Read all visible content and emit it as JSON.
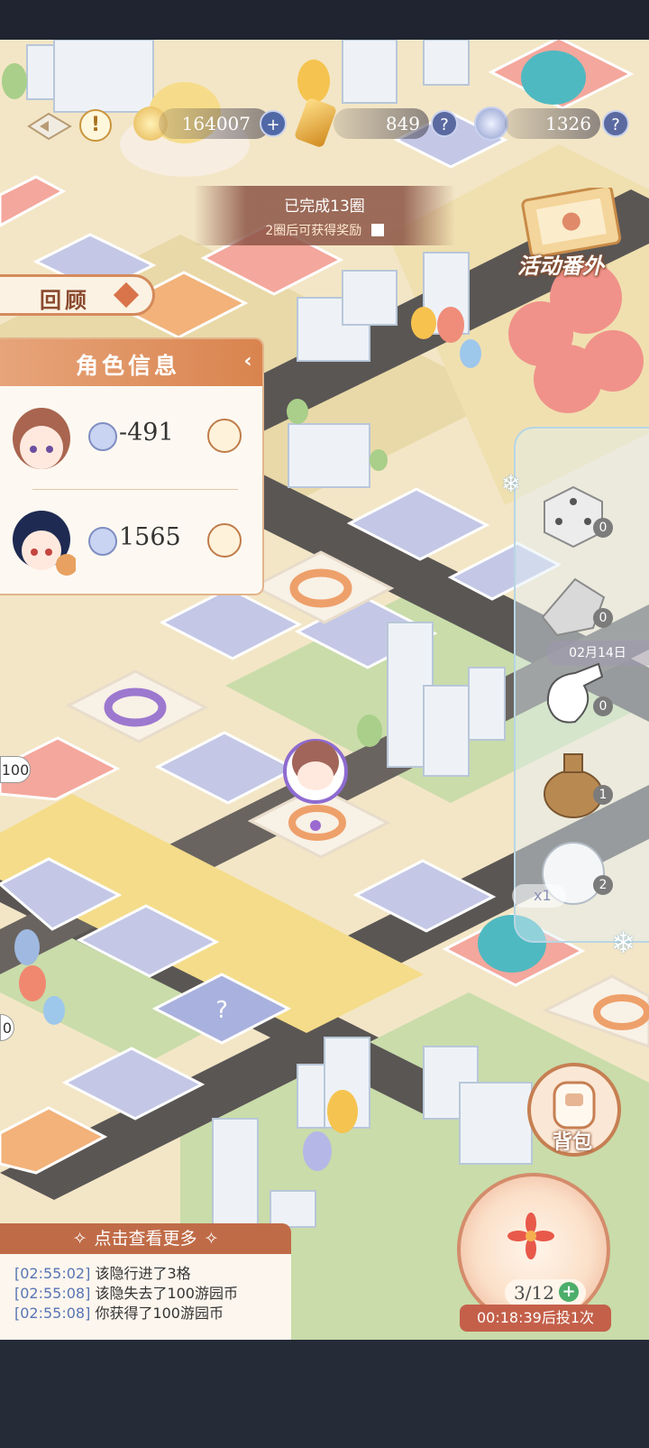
{
  "currencies": [
    {
      "value": "164007",
      "icon": "star-coin-icon",
      "action": "+"
    },
    {
      "value": "849",
      "icon": "gold-crystal-icon",
      "action": "?"
    },
    {
      "value": "1326",
      "icon": "silver-coin-icon",
      "action": "?"
    }
  ],
  "round_banner": {
    "completed": "已完成13圈",
    "reward_hint": "2圈后可获得奖励"
  },
  "event": {
    "label": "活动番外"
  },
  "review_button": {
    "label": "回顾"
  },
  "character_panel": {
    "title": "角色信息",
    "characters": [
      {
        "value": "-491"
      },
      {
        "value": "1565"
      }
    ]
  },
  "items": [
    {
      "name": "dice",
      "count": "0"
    },
    {
      "name": "silver-shoe",
      "count": "0"
    },
    {
      "name": "white-glove",
      "count": "0"
    },
    {
      "name": "coin-sack",
      "count": "1"
    },
    {
      "name": "snowball",
      "count": "2"
    }
  ],
  "item_date": "02月14日",
  "board": {
    "tile_value_left": "100",
    "tile_value_bottom_left": "0",
    "item_price": "x1"
  },
  "backpack": {
    "label": "背包"
  },
  "dice": {
    "count": "3/12",
    "timer": "00:18:39后投1次"
  },
  "log": {
    "header": "点击查看更多",
    "entries": [
      {
        "time": "[02:55:02]",
        "text": "该隐行进了3格"
      },
      {
        "time": "[02:55:08]",
        "text": "该隐失去了100游园币"
      },
      {
        "time": "[02:55:08]",
        "text": "你获得了100游园币"
      }
    ]
  },
  "colors": {
    "accent": "#d9844e",
    "tile_blue": "#c4c8e6",
    "tile_pink": "#f4a79c",
    "road": "#5a5654",
    "grass": "#c9dcaa"
  }
}
